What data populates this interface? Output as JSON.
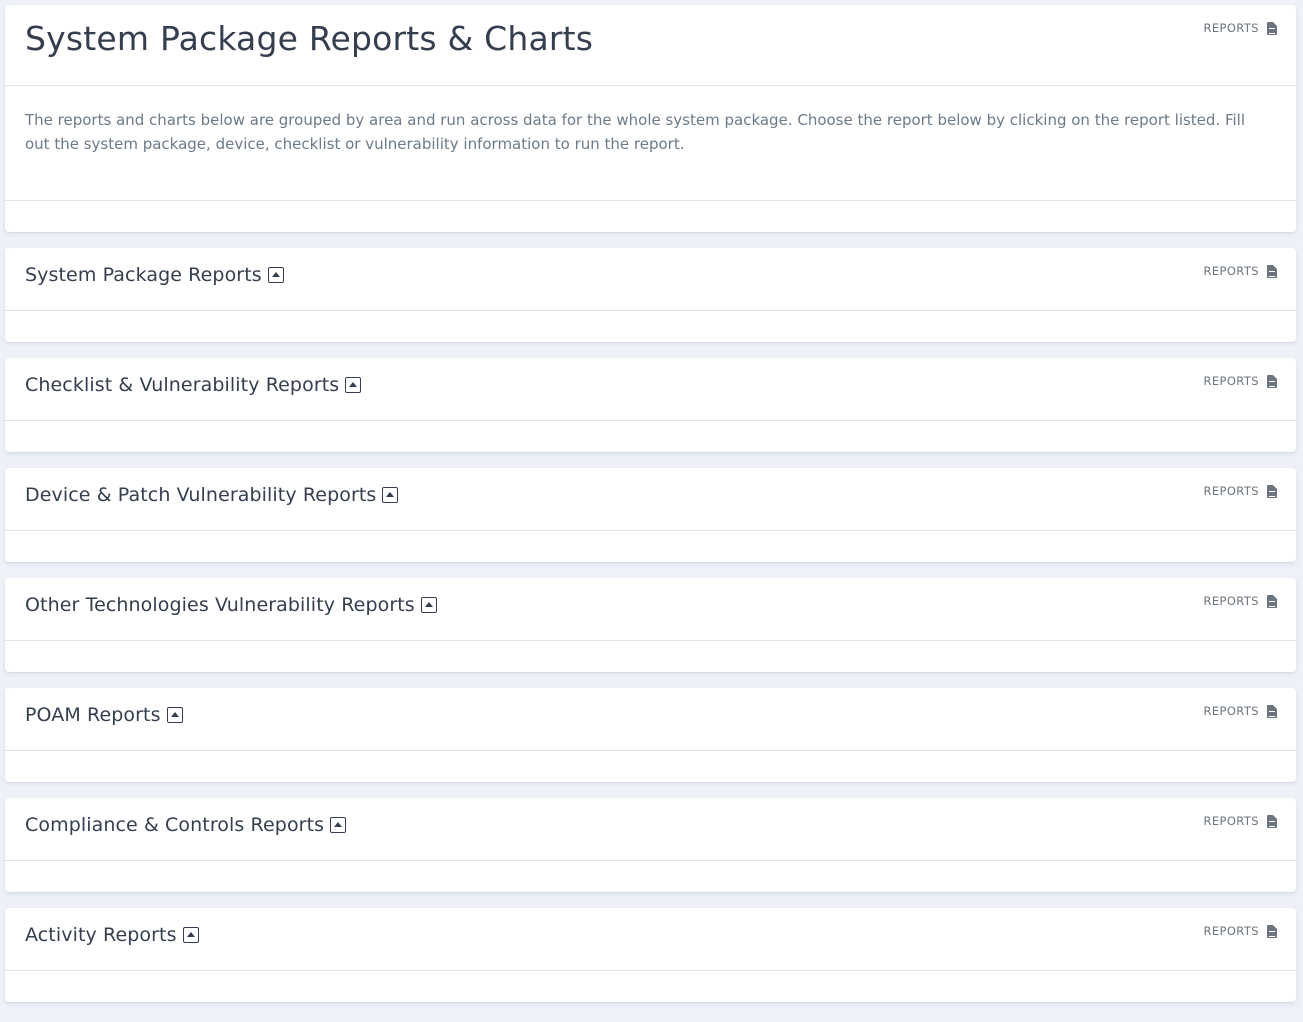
{
  "page": {
    "title": "System Package Reports & Charts",
    "reports_label": "REPORTS",
    "description": "The reports and charts below are grouped by area and run across data for the whole system package. Choose the report below by clicking on the report listed. Fill out the system package, device, checklist or vulnerability information to run the report."
  },
  "sections": [
    {
      "title": "System Package Reports",
      "reports_label": "REPORTS"
    },
    {
      "title": "Checklist & Vulnerability Reports",
      "reports_label": "REPORTS"
    },
    {
      "title": "Device & Patch Vulnerability Reports",
      "reports_label": "REPORTS"
    },
    {
      "title": "Other Technologies Vulnerability Reports",
      "reports_label": "REPORTS"
    },
    {
      "title": "POAM Reports",
      "reports_label": "REPORTS"
    },
    {
      "title": "Compliance & Controls Reports",
      "reports_label": "REPORTS"
    },
    {
      "title": "Activity Reports",
      "reports_label": "REPORTS"
    }
  ],
  "icons": {
    "reports": "file-alt-icon",
    "collapse": "caret-square-up-icon"
  },
  "colors": {
    "background": "#eef1f7",
    "card": "#ffffff",
    "heading": "#343e4f",
    "muted": "#6c757d",
    "description": "#6c7a89",
    "border": "#dfe3ea"
  }
}
